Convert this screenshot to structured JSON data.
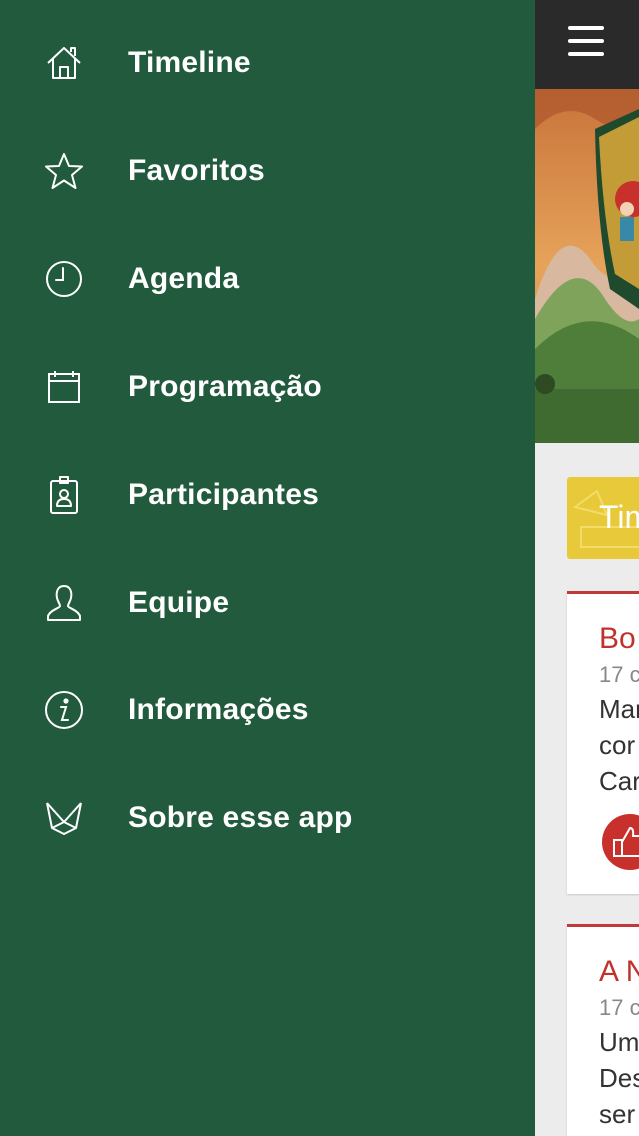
{
  "menu": {
    "items": [
      {
        "label": "Timeline",
        "icon": "home-icon"
      },
      {
        "label": "Favoritos",
        "icon": "star-icon"
      },
      {
        "label": "Agenda",
        "icon": "clock-icon"
      },
      {
        "label": "Programação",
        "icon": "calendar-icon"
      },
      {
        "label": "Participantes",
        "icon": "badge-icon"
      },
      {
        "label": "Equipe",
        "icon": "person-icon"
      },
      {
        "label": "Informações",
        "icon": "info-icon"
      },
      {
        "label": "Sobre esse app",
        "icon": "envelope-icon"
      }
    ]
  },
  "content": {
    "timeline_chip": "Tim",
    "cards": [
      {
        "title": "Bo",
        "date": "17 c",
        "lines": [
          "Mar",
          "cor",
          "Car"
        ]
      },
      {
        "title": "A N",
        "date": "17 c",
        "lines": [
          "Um",
          "Des",
          "ser"
        ]
      }
    ]
  },
  "colors": {
    "drawer_bg": "#225a3d",
    "topbar_bg": "#2a2a2a",
    "accent_red": "#c0332d",
    "chip_yellow": "#e7c93a"
  }
}
